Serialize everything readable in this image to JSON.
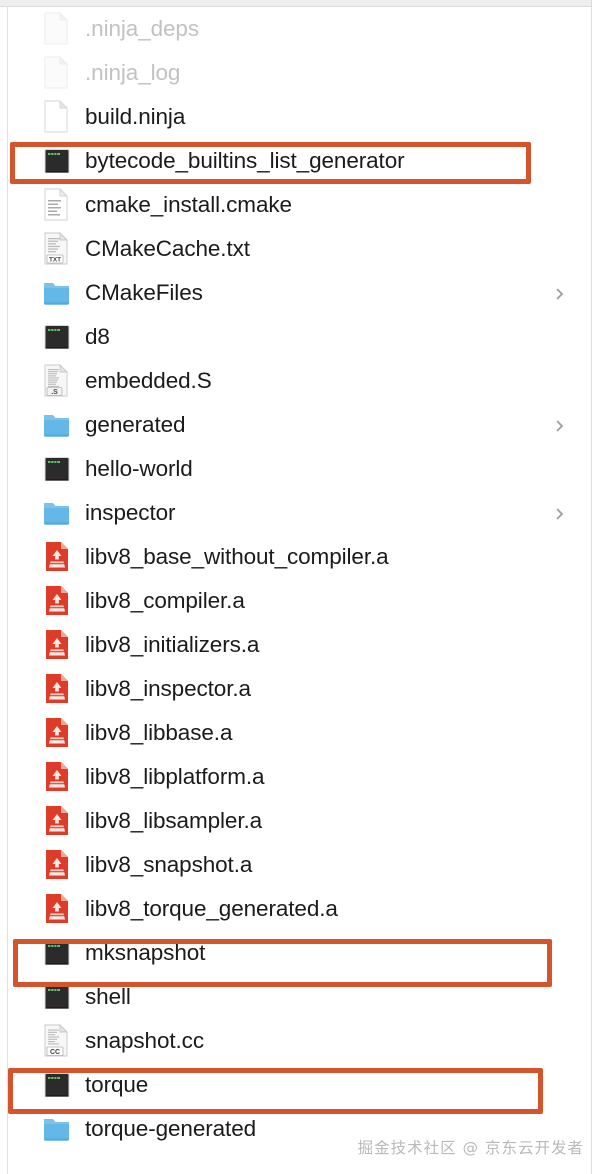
{
  "window": {
    "kind": "file-browser-column",
    "colors": {
      "highlight": "#d4542c",
      "folder_blue": "#63b8e8",
      "archive_red": "#dc3c28",
      "executable_dark": "#2b2b2b",
      "text": "#1b1b1b",
      "text_dimmed": "#c2c2c2"
    }
  },
  "watermark": {
    "text": "掘金技术社区 @ 京东云开发者"
  },
  "file_list": {
    "items": [
      {
        "name": ".ninja_deps",
        "icon": "document-icon",
        "dimmed": true,
        "chevron": false,
        "highlighted": false
      },
      {
        "name": ".ninja_log",
        "icon": "document-icon",
        "dimmed": true,
        "chevron": false,
        "highlighted": false
      },
      {
        "name": "build.ninja",
        "icon": "document-icon",
        "dimmed": false,
        "chevron": false,
        "highlighted": false
      },
      {
        "name": "bytecode_builtins_list_generator",
        "icon": "executable-icon",
        "dimmed": false,
        "chevron": false,
        "highlighted": true
      },
      {
        "name": "cmake_install.cmake",
        "icon": "script-document-icon",
        "dimmed": false,
        "chevron": false,
        "highlighted": false
      },
      {
        "name": "CMakeCache.txt",
        "icon": "txt-document-icon",
        "dimmed": false,
        "chevron": false,
        "highlighted": false
      },
      {
        "name": "CMakeFiles",
        "icon": "folder-icon",
        "dimmed": false,
        "chevron": true,
        "highlighted": false
      },
      {
        "name": "d8",
        "icon": "executable-icon",
        "dimmed": false,
        "chevron": false,
        "highlighted": false
      },
      {
        "name": "embedded.S",
        "icon": "asm-document-icon",
        "dimmed": false,
        "chevron": false,
        "highlighted": false
      },
      {
        "name": "generated",
        "icon": "folder-icon",
        "dimmed": false,
        "chevron": true,
        "highlighted": false
      },
      {
        "name": "hello-world",
        "icon": "executable-icon",
        "dimmed": false,
        "chevron": false,
        "highlighted": false
      },
      {
        "name": "inspector",
        "icon": "folder-icon",
        "dimmed": false,
        "chevron": true,
        "highlighted": false
      },
      {
        "name": "libv8_base_without_compiler.a",
        "icon": "archive-icon",
        "dimmed": false,
        "chevron": false,
        "highlighted": false
      },
      {
        "name": "libv8_compiler.a",
        "icon": "archive-icon",
        "dimmed": false,
        "chevron": false,
        "highlighted": false
      },
      {
        "name": "libv8_initializers.a",
        "icon": "archive-icon",
        "dimmed": false,
        "chevron": false,
        "highlighted": false
      },
      {
        "name": "libv8_inspector.a",
        "icon": "archive-icon",
        "dimmed": false,
        "chevron": false,
        "highlighted": false
      },
      {
        "name": "libv8_libbase.a",
        "icon": "archive-icon",
        "dimmed": false,
        "chevron": false,
        "highlighted": false
      },
      {
        "name": "libv8_libplatform.a",
        "icon": "archive-icon",
        "dimmed": false,
        "chevron": false,
        "highlighted": false
      },
      {
        "name": "libv8_libsampler.a",
        "icon": "archive-icon",
        "dimmed": false,
        "chevron": false,
        "highlighted": false
      },
      {
        "name": "libv8_snapshot.a",
        "icon": "archive-icon",
        "dimmed": false,
        "chevron": false,
        "highlighted": false
      },
      {
        "name": "libv8_torque_generated.a",
        "icon": "archive-icon",
        "dimmed": false,
        "chevron": false,
        "highlighted": false
      },
      {
        "name": "mksnapshot",
        "icon": "executable-icon",
        "dimmed": false,
        "chevron": false,
        "highlighted": true
      },
      {
        "name": "shell",
        "icon": "executable-icon",
        "dimmed": false,
        "chevron": false,
        "highlighted": false
      },
      {
        "name": "snapshot.cc",
        "icon": "cc-document-icon",
        "dimmed": false,
        "chevron": false,
        "highlighted": false
      },
      {
        "name": "torque",
        "icon": "executable-icon",
        "dimmed": false,
        "chevron": false,
        "highlighted": true
      },
      {
        "name": "torque-generated",
        "icon": "folder-icon",
        "dimmed": false,
        "chevron": false,
        "highlighted": false
      }
    ]
  },
  "icon_badges": {
    "txt": "TXT",
    "asm": ".S",
    "cc": "CC"
  }
}
